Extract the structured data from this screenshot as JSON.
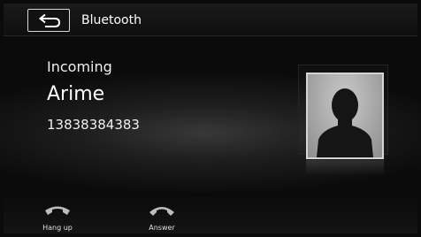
{
  "header": {
    "title": "Bluetooth",
    "back_icon": "return-arrow-icon"
  },
  "call": {
    "status": "Incoming",
    "caller_name": "Arime",
    "caller_number": "13838384383",
    "avatar_icon": "person-silhouette-icon"
  },
  "actions": {
    "hangup_label": "Hang up",
    "hangup_icon": "phone-hangup-icon",
    "answer_label": "Answer",
    "answer_icon": "phone-answer-icon"
  },
  "colors": {
    "background": "#0b0b0b",
    "text": "#ffffff",
    "icon": "#bdbdbd"
  }
}
